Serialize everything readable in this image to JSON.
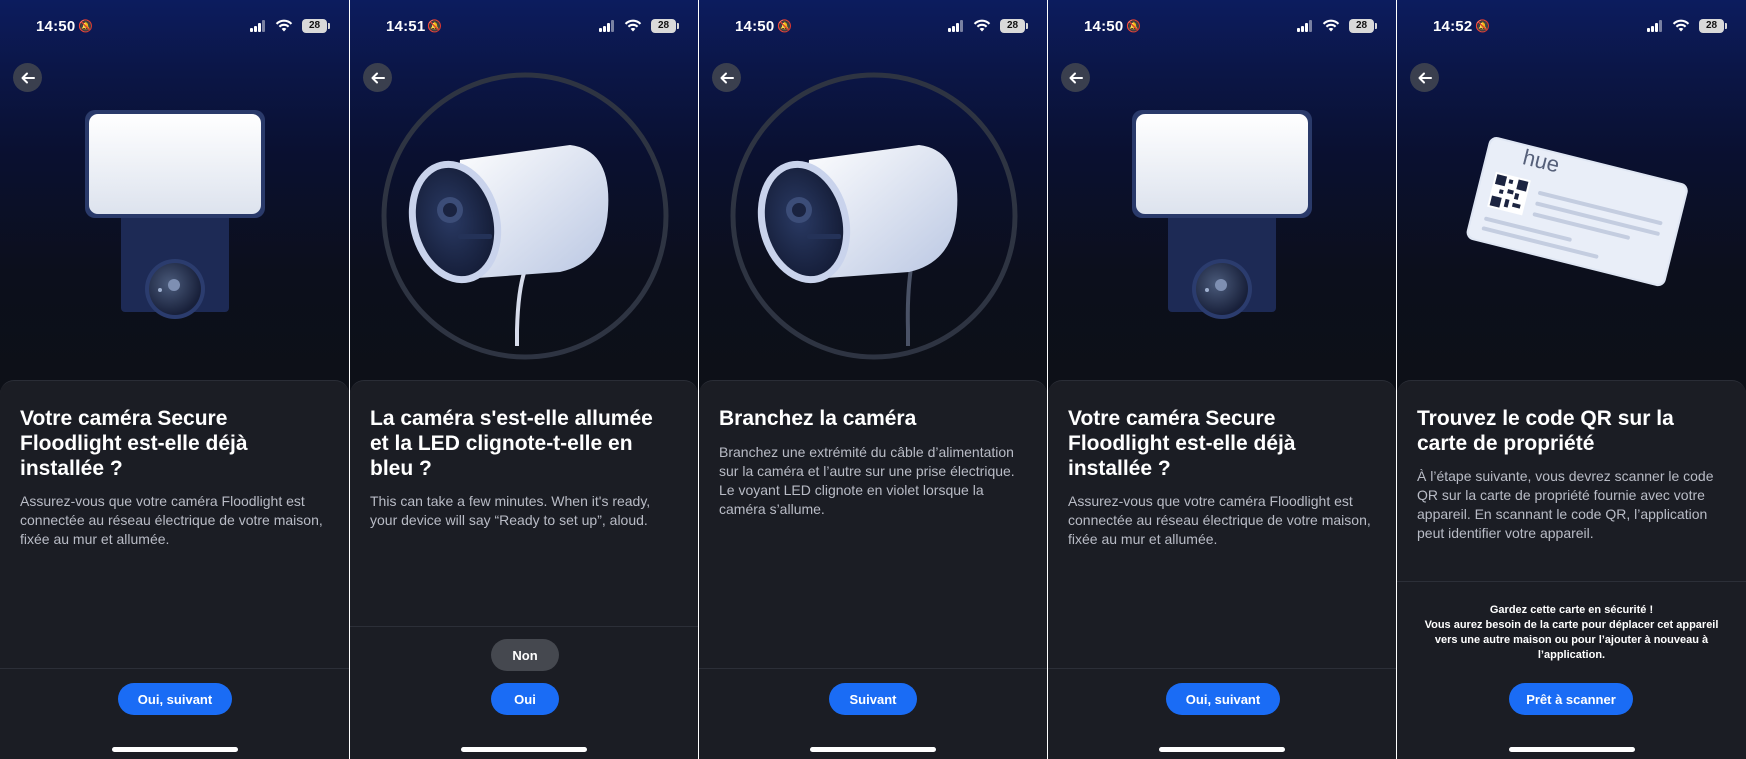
{
  "screens": [
    {
      "status": {
        "time": "14:50",
        "battery": "28"
      },
      "title": "Votre caméra Secure Floodlight est-elle déjà installée ?",
      "body": "Assurez-vous que votre caméra Floodlight est connectée au réseau électrique de votre maison, fixée au mur et allumée.",
      "primary_button": "Oui, suivant"
    },
    {
      "status": {
        "time": "14:51",
        "battery": "28"
      },
      "title": "La caméra s'est-elle allumée et la LED clignote-t-elle en bleu ?",
      "body": "This can take a few minutes. When it's ready, your device will say “Ready to set up”, aloud.",
      "secondary_button": "Non",
      "primary_button": "Oui"
    },
    {
      "status": {
        "time": "14:50",
        "battery": "28"
      },
      "title": "Branchez la caméra",
      "body": "Branchez une extrémité du câble d’alimentation sur la caméra et l’autre sur une prise électrique. Le voyant LED clignote en violet lorsque la caméra s’allume.",
      "primary_button": "Suivant"
    },
    {
      "status": {
        "time": "14:50",
        "battery": "28"
      },
      "title": "Votre caméra Secure Floodlight est-elle déjà installée ?",
      "body": "Assurez-vous que votre caméra Floodlight est connectée au réseau électrique de votre maison, fixée au mur et allumée.",
      "primary_button": "Oui, suivant"
    },
    {
      "status": {
        "time": "14:52",
        "battery": "28"
      },
      "title": "Trouvez le code QR sur la carte de propriété",
      "body": "À l’étape suivante, vous devrez scanner le code QR sur la carte de propriété fournie avec votre appareil. En scannant le code QR, l’application peut identifier votre appareil.",
      "card_brand": "hue",
      "notice_title": "Gardez cette carte en sécurité !",
      "notice_body": "Vous aurez besoin de la carte pour déplacer cet appareil vers une autre maison ou pour l’ajouter à nouveau à l’application.",
      "primary_button": "Prêt à scanner"
    }
  ],
  "colors": {
    "accent": "#1a6cf5",
    "sheet": "#1b1d24",
    "hero_top": "#0c1c5e",
    "secondary_button": "#45484f"
  },
  "icons": [
    "back-arrow-icon",
    "mute-bell-icon",
    "cellular-signal-icon",
    "wifi-icon",
    "battery-icon"
  ]
}
